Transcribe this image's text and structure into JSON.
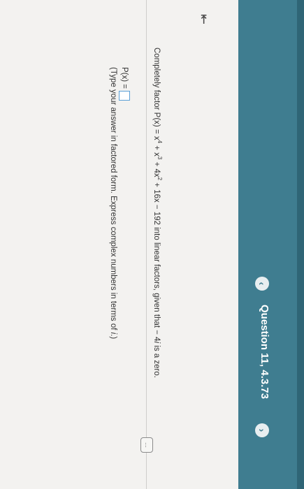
{
  "header": {
    "title": "Question 11, 4.3.73",
    "prev_icon": "chevron-left-icon",
    "next_icon": "chevron-right-icon"
  },
  "toolbar": {
    "back_icon": "collapse-left-icon",
    "more_label": "..."
  },
  "question": {
    "prefix": "Completely factor P(x) = x",
    "exp1": "4",
    "mid1": " + x",
    "exp2": "3",
    "mid2": " + 4x",
    "exp3": "2",
    "suffix": " + 16x − 192 into linear factors, given that − 4",
    "i_var": "i",
    "end": " is a zero."
  },
  "answer": {
    "label": "P(x) =",
    "value": ""
  },
  "instruction": {
    "text": "(Type your answer in factored form. Express complex numbers in terms of ",
    "i_var": "i",
    "end": ".)"
  },
  "colors": {
    "header": "#3f7d90",
    "input_border": "#5a9fd6",
    "tab_highlight": "#ecd99a"
  }
}
